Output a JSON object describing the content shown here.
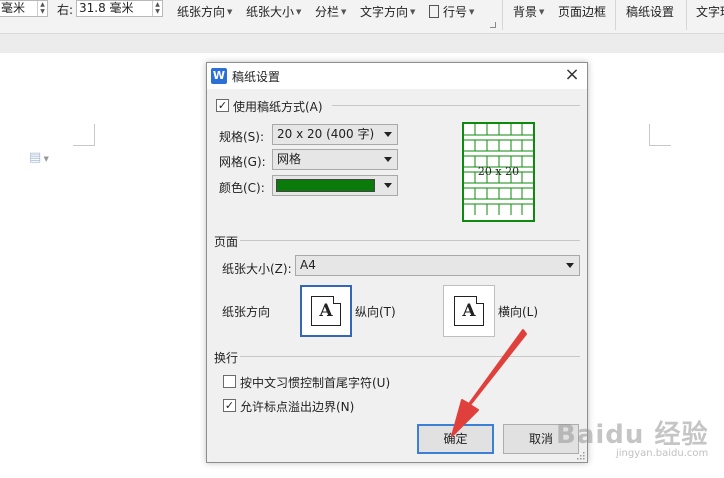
{
  "ribbon": {
    "left_unit": "毫米",
    "right_label": "右:",
    "right_value": "31.8 毫米",
    "paper_orientation": "纸张方向",
    "paper_size": "纸张大小",
    "columns": "分栏",
    "text_direction": "文字方向",
    "line_numbers": "行号",
    "background": "背景",
    "page_border": "页面边框",
    "draft_paper_settings": "稿纸设置",
    "text_wrap": "文字环"
  },
  "dialog": {
    "title": "稿纸设置",
    "close_glyph": "×",
    "use_draft_mode_label": "使用稿纸方式(A)",
    "use_draft_mode_checked": true,
    "spec_label": "规格(S):",
    "spec_value": "20 x 20 (400 字)",
    "grid_label": "网格(G):",
    "grid_value": "网格",
    "color_label": "颜色(C):",
    "color_value": "#0a7a0a",
    "preview_text": "20 x 20",
    "page_section": "页面",
    "paper_size_label": "纸张大小(Z):",
    "paper_size_value": "A4",
    "orientation_label": "纸张方向",
    "portrait_label": "纵向(T)",
    "landscape_label": "横向(L)",
    "orientation_glyph": "A",
    "selected_orientation": "portrait",
    "line_break_section": "换行",
    "chinese_control_label": "按中文习惯控制首尾字符(U)",
    "chinese_control_checked": false,
    "allow_punct_label": "允许标点溢出边界(N)",
    "allow_punct_checked": true,
    "ok_label": "确定",
    "cancel_label": "取消"
  },
  "watermark": {
    "brand": "Baidu 经验",
    "url": "jingyan.baidu.com"
  },
  "colors": {
    "grid_green": "#0e8a0e",
    "accent_blue": "#3c7fd6",
    "annotation_red": "#e0403c"
  }
}
